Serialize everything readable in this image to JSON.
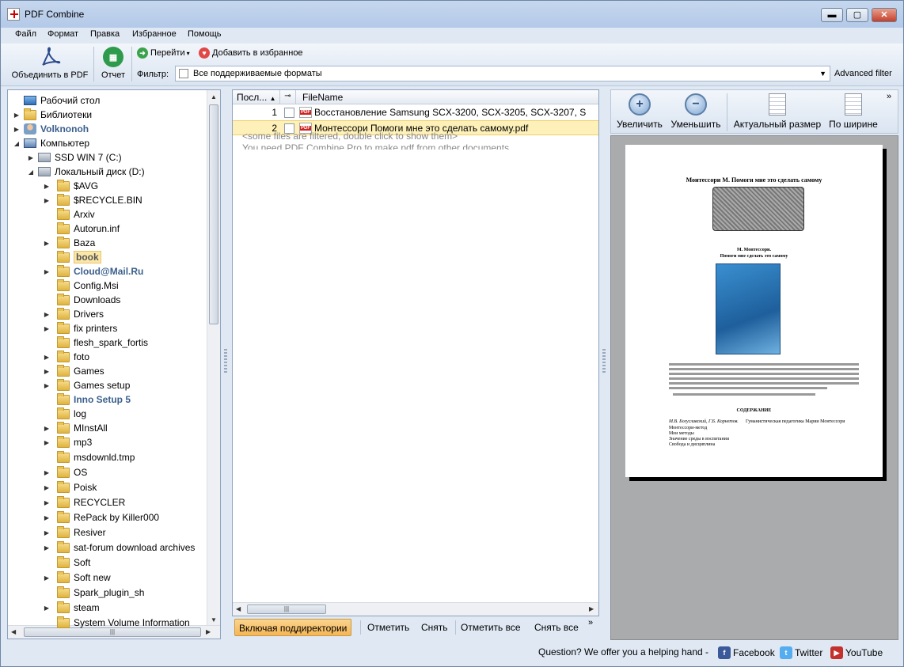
{
  "window": {
    "title": "PDF Combine",
    "minimize": "▬",
    "maximize": "▢",
    "close": "✕"
  },
  "menu": [
    "Файл",
    "Формат",
    "Правка",
    "Избранное",
    "Помощь"
  ],
  "toolbar": {
    "combine_label": "Объединить в PDF",
    "report_label": "Отчет",
    "goto_label": "Перейти",
    "fav_label": "Добавить в избранное",
    "filter_label": "Фильтр:",
    "filter_value": "Все поддерживаемые форматы",
    "advanced_label": "Advanced filter"
  },
  "tree": {
    "top": [
      {
        "label": "Рабочий стол",
        "icon": "desktop-icon"
      },
      {
        "label": "Библиотеки",
        "icon": "library-icon"
      },
      {
        "label": "Volknonoh",
        "icon": "user-icon"
      },
      {
        "label": "Компьютер",
        "icon": "computer-icon"
      },
      {
        "label": "SSD WIN 7 (C:)",
        "icon": "drive-icon"
      },
      {
        "label": "Локальный диск (D:)",
        "icon": "drive-icon"
      }
    ],
    "folders": [
      "$AVG",
      "$RECYCLE.BIN",
      "Arxiv",
      "Autorun.inf",
      "Baza",
      "book",
      "Cloud@Mail.Ru",
      "Config.Msi",
      "Downloads",
      "Drivers",
      "fix printers",
      "flesh_spark_fortis",
      "foto",
      "Games",
      "Games setup",
      "Inno Setup 5",
      "log",
      "MInstAll",
      "mp3",
      "msdownld.tmp",
      "OS",
      "Poisk",
      "RECYCLER",
      "RePack by Killer000",
      "Resiver",
      "sat-forum download archives",
      "Soft",
      "Soft new",
      "Spark_plugin_sh",
      "steam",
      "System Volume Information"
    ]
  },
  "list": {
    "col_order": "Посл...",
    "col_filename": "FileName",
    "rows": [
      {
        "num": "1",
        "name": "Восстановление Samsung SCX-3200, SCX-3205, SCX-3207, S"
      },
      {
        "num": "2",
        "name": "Монтессори Помоги мне это сделать самому.pdf"
      }
    ],
    "note1": "<some files are filtered, double click to show them>",
    "note2": "You need PDF Combine Pro to make pdf from other documents"
  },
  "list_actions": {
    "subdirs": "Включая поддиректории",
    "mark": "Отметить",
    "unmark": "Снять",
    "mark_all": "Отметить все",
    "unmark_all": "Снять все"
  },
  "preview": {
    "zoom_in": "Увеличить",
    "zoom_out": "Уменьшить",
    "actual": "Актуальный размер",
    "fit_width": "По ширине",
    "page_title": "Монтессори М. Помоги мне это сделать самому",
    "author": "М. Монтессори.",
    "book_title": "Помоги мне сделать это самому",
    "contents": "СОДЕРЖАНИЕ",
    "toc1_author": "М.В. Богуславский, Г.Б. Корнетов.",
    "toc1": "Гуманистическая педагогика Марии Монтессори",
    "toc2": "Монтессори-метод",
    "toc3": "Мои методы",
    "toc4": "Значение среды в воспитании",
    "toc5": "Свобода и дисциплина"
  },
  "status": {
    "question": "Question? We offer you a helping hand -",
    "facebook": "Facebook",
    "twitter": "Twitter",
    "youtube": "YouTube"
  }
}
